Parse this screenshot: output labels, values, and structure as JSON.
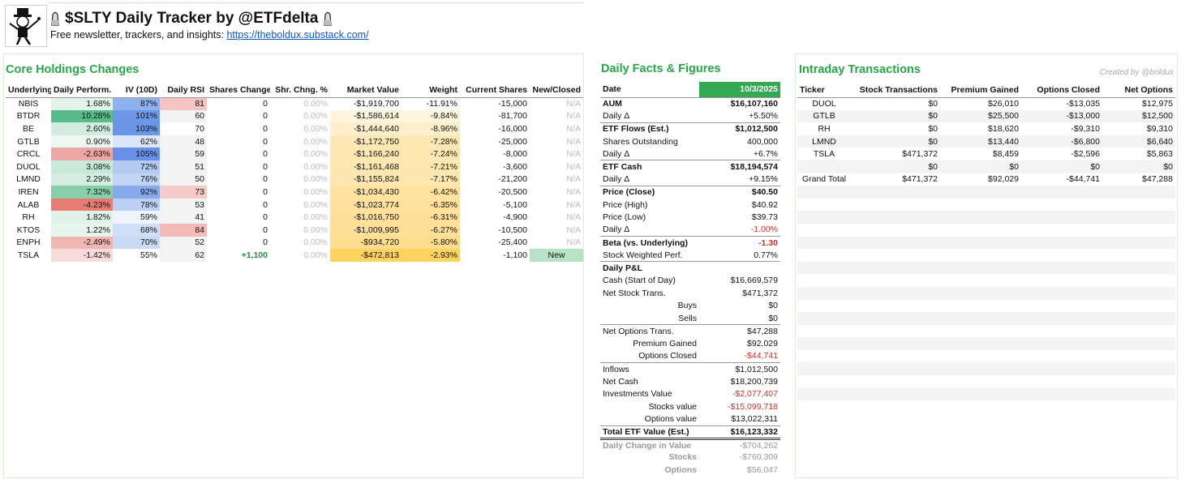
{
  "header": {
    "title": "$SLTY Daily Tracker by @ETFdelta",
    "subtitle_text": "Free newsletter, trackers, and insights: ",
    "subtitle_link": "https://theboldux.substack.com/"
  },
  "colors": {
    "brand_green": "#27a848",
    "date_bg": "#34a853",
    "negative": "#d93025",
    "link": "#1155cc"
  },
  "core": {
    "title": "Core Holdings Changes",
    "columns": [
      "Underlying",
      "Daily Perform.",
      "IV (10D)",
      "Daily RSI",
      "Shares Change",
      "Shr. Chng. %",
      "Market Value",
      "Weight",
      "Current Shares",
      "New/Closed"
    ],
    "rows": [
      [
        "NBIS",
        "1.68%",
        "87%",
        "81",
        "0",
        "0.00%",
        "-$1,919,700",
        "-11.91%",
        "-15,000",
        "N/A"
      ],
      [
        "BTDR",
        "10.28%",
        "101%",
        "60",
        "0",
        "0.00%",
        "-$1,586,614",
        "-9.84%",
        "-81,700",
        "N/A"
      ],
      [
        "BE",
        "2.60%",
        "103%",
        "70",
        "0",
        "0.00%",
        "-$1,444,640",
        "-8.96%",
        "-16,000",
        "N/A"
      ],
      [
        "GTLB",
        "0.90%",
        "62%",
        "48",
        "0",
        "0.00%",
        "-$1,172,750",
        "-7.28%",
        "-25,000",
        "N/A"
      ],
      [
        "CRCL",
        "-2.63%",
        "105%",
        "59",
        "0",
        "0.00%",
        "-$1,166,240",
        "-7.24%",
        "-8,000",
        "N/A"
      ],
      [
        "DUOL",
        "3.08%",
        "72%",
        "51",
        "0",
        "0.00%",
        "-$1,161,468",
        "-7.21%",
        "-3,600",
        "N/A"
      ],
      [
        "LMND",
        "2.29%",
        "76%",
        "50",
        "0",
        "0.00%",
        "-$1,155,824",
        "-7.17%",
        "-21,200",
        "N/A"
      ],
      [
        "IREN",
        "7.32%",
        "92%",
        "73",
        "0",
        "0.00%",
        "-$1,034,430",
        "-6.42%",
        "-20,500",
        "N/A"
      ],
      [
        "ALAB",
        "-4.23%",
        "78%",
        "53",
        "0",
        "0.00%",
        "-$1,023,774",
        "-6.35%",
        "-5,100",
        "N/A"
      ],
      [
        "RH",
        "1.82%",
        "59%",
        "41",
        "0",
        "0.00%",
        "-$1,016,750",
        "-6.31%",
        "-4,900",
        "N/A"
      ],
      [
        "KTOS",
        "1.22%",
        "68%",
        "84",
        "0",
        "0.00%",
        "-$1,009,995",
        "-6.27%",
        "-10,500",
        "N/A"
      ],
      [
        "ENPH",
        "-2.49%",
        "70%",
        "52",
        "0",
        "0.00%",
        "-$934,720",
        "-5.80%",
        "-25,400",
        "N/A"
      ],
      [
        "TSLA",
        "-1.42%",
        "55%",
        "62",
        "+1,100",
        "0.00%",
        "-$472,813",
        "-2.93%",
        "-1,100",
        "New"
      ]
    ],
    "perf_bg": [
      "#e3f3ea",
      "#57bb8a",
      "#d2ede0",
      "#ecf7f1",
      "#eba8a4",
      "#c8e9d8",
      "#d6eee2",
      "#86cfaa",
      "#e67c73",
      "#e0f2e8",
      "#e6f5ed",
      "#f0b6b2",
      "#f8dcdb"
    ],
    "iv_bg": [
      "#8fb1ee",
      "#6d98e8",
      "#6a96e8",
      "#dbe6fa",
      "#6791e6",
      "#b3caf3",
      "#c2d4f5",
      "#86aaec",
      "#bcd0f4",
      "#eef3fd",
      "#d0def7",
      "#cad9f6",
      "#ffffff"
    ],
    "rsi_bg": [
      "#f5c3c1",
      "#f3f3f3",
      "#ffffff",
      "#f3f3f3",
      "#f3f3f3",
      "#f3f3f3",
      "#f3f3f3",
      "#f6cac8",
      "#f3f3f3",
      "#f3f3f3",
      "#f4bbb8",
      "#f3f3f3",
      "#f3f3f3"
    ],
    "mv_bg": [
      "#ffffff",
      "#fff4dc",
      "#ffefcc",
      "#ffe8b3",
      "#ffe7b1",
      "#ffe7b0",
      "#ffe6ae",
      "#ffe29f",
      "#ffe19d",
      "#ffe09b",
      "#ffe099",
      "#ffdd8f",
      "#ffd35f"
    ]
  },
  "facts": {
    "title": "Daily Facts & Figures",
    "date_label": "Date",
    "date_value": "10/3/2025",
    "rows": [
      {
        "label": "AUM",
        "value": "$16,107,160",
        "bold": true,
        "sep": true
      },
      {
        "label": "Daily Δ",
        "value": "+5.50%"
      },
      {
        "label": "ETF Flows (Est.)",
        "value": "$1,012,500",
        "bold": true,
        "sep": true
      },
      {
        "label": "Shares Outstanding",
        "value": "400,000"
      },
      {
        "label": "Daily Δ",
        "value": "+6.7%"
      },
      {
        "label": "ETF Cash",
        "value": "$18,194,574",
        "bold": true,
        "sep": true
      },
      {
        "label": "Daily Δ",
        "value": "+9.15%"
      },
      {
        "label": "Price (Close)",
        "value": "$40.50",
        "bold": true,
        "sep": true
      },
      {
        "label": "Price (High)",
        "value": "$40.92"
      },
      {
        "label": "Price (Low)",
        "value": "$39.73"
      },
      {
        "label": "Daily Δ",
        "value": "-1.00%",
        "red": true
      },
      {
        "label": "Beta (vs. Underlying)",
        "value": "-1.30",
        "bold": true,
        "red": true,
        "sep": true
      },
      {
        "label": "Stock Weighted Perf.",
        "value": "0.77%"
      },
      {
        "label": "Daily P&L",
        "value": "",
        "bold": true,
        "sep": true
      },
      {
        "label": "Cash (Start of Day)",
        "value": "$16,669,579"
      },
      {
        "label": "Net Stock Trans.",
        "value": "$471,372"
      },
      {
        "label": "Buys",
        "value": "$0",
        "indent": "right"
      },
      {
        "label": "Sells",
        "value": "$0",
        "indent": "right"
      },
      {
        "label": "Net Options Trans.",
        "value": "$47,288",
        "sep": true
      },
      {
        "label": "Premium Gained",
        "value": "$92,029",
        "indent": "right"
      },
      {
        "label": "Options Closed",
        "value": "-$44,741",
        "indent": "right",
        "red": true
      },
      {
        "label": "Inflows",
        "value": "$1,012,500",
        "sep": true
      },
      {
        "label": "Net Cash",
        "value": "$18,200,739"
      },
      {
        "label": "Investments Value",
        "value": "-$2,077,407",
        "red": true
      },
      {
        "label": "Stocks value",
        "value": "-$15,099,718",
        "indent": "right",
        "red": true
      },
      {
        "label": "Options value",
        "value": "$13,022,311",
        "indent": "right"
      },
      {
        "label": "Total ETF Value (Est.)",
        "value": "$16,123,332",
        "bold": true,
        "sep": true,
        "dsep": true
      },
      {
        "label": "Daily Change in Value",
        "value": "-$704,262",
        "muted": true,
        "red": true
      },
      {
        "label": "Stocks",
        "value": "-$760,309",
        "muted": true,
        "red": true,
        "indent": "right"
      },
      {
        "label": "Options",
        "value": "$56,047",
        "muted": true,
        "indent": "right"
      }
    ]
  },
  "intraday": {
    "title": "Intraday Transactions",
    "credit": "Created by @boldux",
    "columns": [
      "Ticker",
      "Stock Transactions",
      "Premium Gained",
      "Options Closed",
      "Net Options"
    ],
    "rows": [
      [
        "DUOL",
        "$0",
        "$26,010",
        "-$13,035",
        "$12,975"
      ],
      [
        "GTLB",
        "$0",
        "$25,500",
        "-$13,000",
        "$12,500"
      ],
      [
        "RH",
        "$0",
        "$18,620",
        "-$9,310",
        "$9,310"
      ],
      [
        "LMND",
        "$0",
        "$13,440",
        "-$6,800",
        "$6,640"
      ],
      [
        "TSLA",
        "$471,372",
        "$8,459",
        "-$2,596",
        "$5,863"
      ],
      [
        "",
        "$0",
        "$0",
        "$0",
        "$0"
      ],
      [
        "Grand Total",
        "$471,372",
        "$92,029",
        "-$44,741",
        "$47,288"
      ]
    ]
  }
}
